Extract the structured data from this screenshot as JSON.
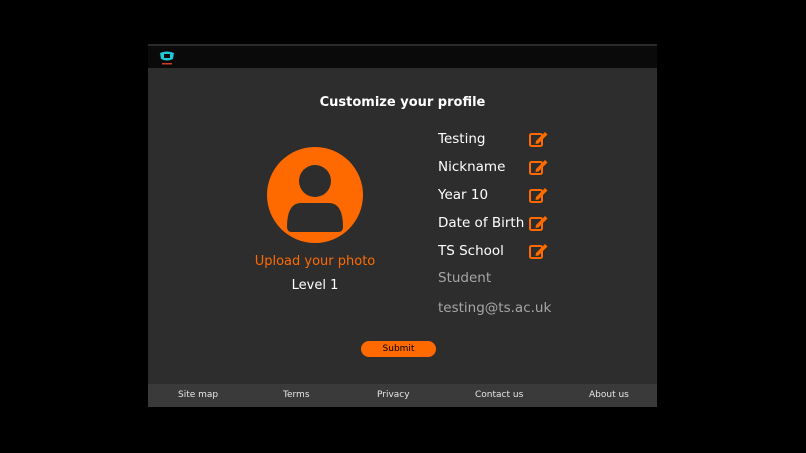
{
  "page": {
    "title": "Customize your profile"
  },
  "profile": {
    "upload_label": "Upload your photo",
    "level": "Level 1",
    "editable_fields": [
      {
        "label": "Testing"
      },
      {
        "label": "Nickname"
      },
      {
        "label": "Year 10"
      },
      {
        "label": "Date of Birth"
      },
      {
        "label": "TS School"
      }
    ],
    "role": "Student",
    "email": "testing@ts.ac.uk",
    "submit_label": "Submit"
  },
  "footer": {
    "links": [
      "Site map",
      "Terms",
      "Privacy",
      "Contact us",
      "About us"
    ]
  },
  "colors": {
    "accent": "#ff6a00",
    "panel": "#2d2d2d",
    "footer": "#3a3a3a",
    "background": "#000000"
  },
  "icons": {
    "logo": "app-logo-icon",
    "avatar": "user-silhouette-icon",
    "edit": "edit-pencil-icon"
  }
}
